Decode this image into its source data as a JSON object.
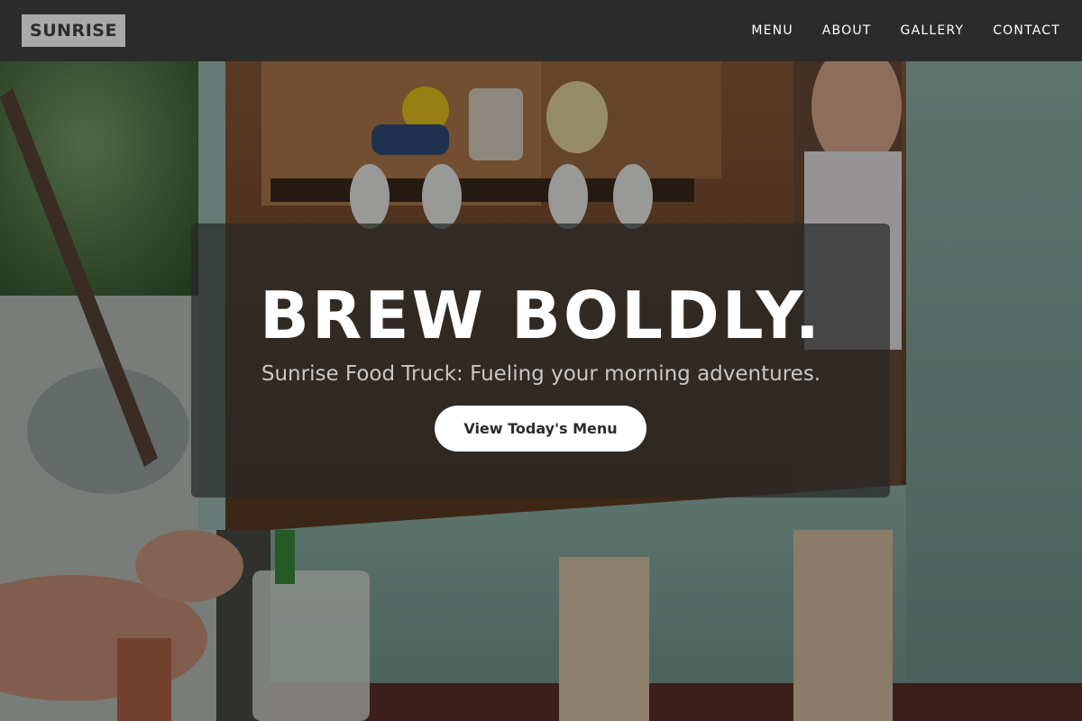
{
  "header": {
    "logo_text": "SUNRISE",
    "nav": [
      {
        "label": "MENU"
      },
      {
        "label": "ABOUT"
      },
      {
        "label": "GALLERY"
      },
      {
        "label": "CONTACT"
      }
    ]
  },
  "hero": {
    "headline": "BREW BOLDLY.",
    "tagline": "Sunrise Food Truck: Fueling your morning adventures.",
    "cta_label": "View Today's Menu"
  },
  "colors": {
    "header_bg": "#2b2b2b",
    "logo_bg": "#a9a9a9",
    "card_bg": "rgba(40,40,40,0.72)",
    "cta_bg": "#ffffff",
    "truck_green": "#7fa89b"
  }
}
